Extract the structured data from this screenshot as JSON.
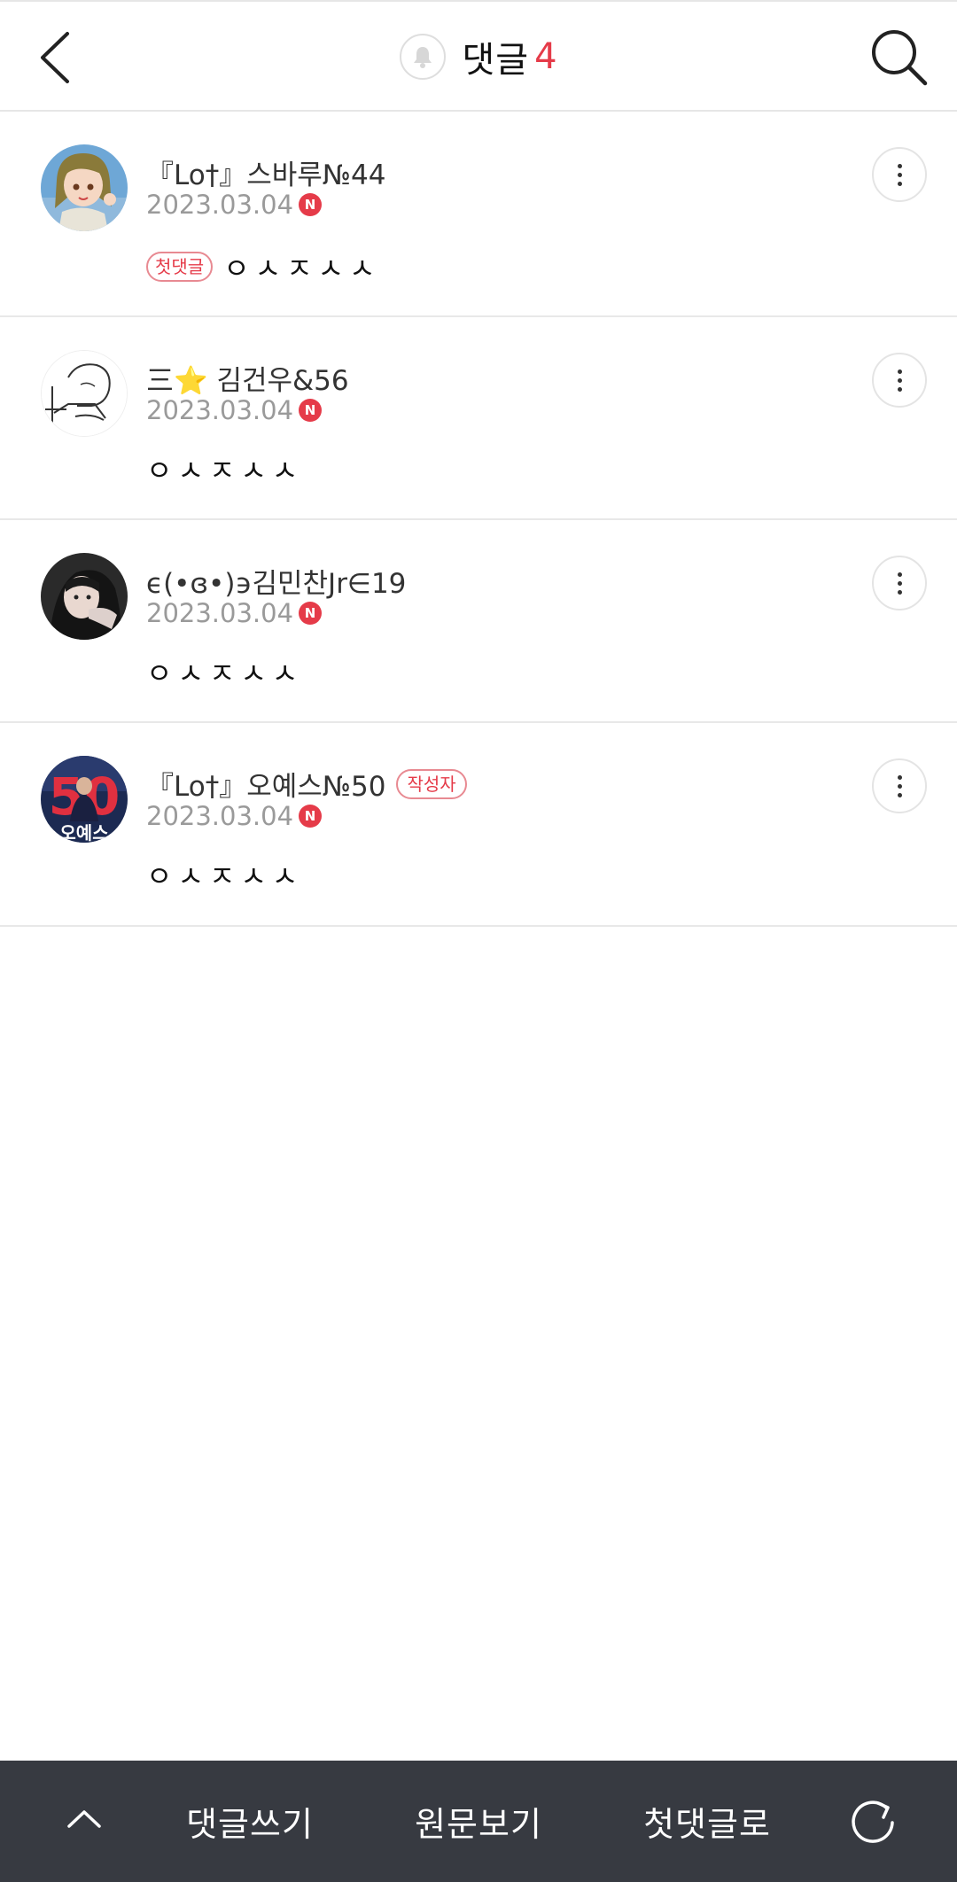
{
  "header": {
    "title": "댓글",
    "count": "4",
    "back_icon": "chevron-left-icon",
    "bell_icon": "bell-icon",
    "search_icon": "search-icon"
  },
  "comments": [
    {
      "name": "『Lo†』스바루№44",
      "date": "2023.03.04",
      "new_badge": "N",
      "first_badge": "첫댓글",
      "text": "ㅇㅅㅈㅅㅅ",
      "avatar": "avatar-anime-girl"
    },
    {
      "name": "三⭐ 김건우&56",
      "date": "2023.03.04",
      "new_badge": "N",
      "text": "ㅇㅅㅈㅅㅅ",
      "avatar": "avatar-sketch"
    },
    {
      "name": "ϵ(•ɞ•)϶김민찬Jr∈19",
      "date": "2023.03.04",
      "new_badge": "N",
      "text": "ㅇㅅㅈㅅㅅ",
      "avatar": "avatar-photo"
    },
    {
      "name": "『Lo†』오예스№50",
      "author_badge": "작성자",
      "date": "2023.03.04",
      "new_badge": "N",
      "text": "ㅇㅅㅈㅅㅅ",
      "avatar": "avatar-baseball-50"
    }
  ],
  "bottom_bar": {
    "up_icon": "chevron-up-icon",
    "write_label": "댓글쓰기",
    "original_label": "원문보기",
    "first_label": "첫댓글로",
    "refresh_icon": "refresh-icon"
  },
  "colors": {
    "accent": "#e53b49",
    "bottom_bar": "#373a41",
    "date_gray": "#9a9a9a"
  }
}
